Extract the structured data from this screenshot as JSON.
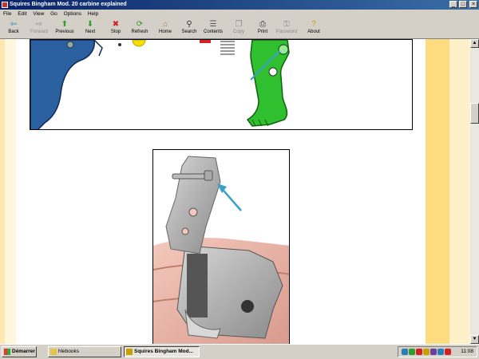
{
  "window": {
    "title": "Squires Bingham Mod. 20 carbine explained",
    "controls": [
      "_",
      "□",
      "×"
    ]
  },
  "menu": [
    "File",
    "Edit",
    "View",
    "Go",
    "Options",
    "Help"
  ],
  "toolbar": [
    {
      "label": "Back",
      "icon": "back-arrow-icon",
      "glyph": "⇦",
      "color": "#2a7fb8",
      "disabled": false
    },
    {
      "label": "Forward",
      "icon": "forward-arrow-icon",
      "glyph": "⇨",
      "color": "#8a8a8a",
      "disabled": true
    },
    {
      "label": "Previous",
      "icon": "up-arrow-icon",
      "glyph": "⬆",
      "color": "#2f9e2f",
      "disabled": false
    },
    {
      "label": "Next",
      "icon": "down-arrow-icon",
      "glyph": "⬇",
      "color": "#2f9e2f",
      "disabled": false
    },
    {
      "label": "Stop",
      "icon": "stop-icon",
      "glyph": "✖",
      "color": "#d42020",
      "disabled": false
    },
    {
      "label": "Refresh",
      "icon": "refresh-icon",
      "glyph": "⟳",
      "color": "#2f9e2f",
      "disabled": false
    },
    {
      "label": "Home",
      "icon": "home-icon",
      "glyph": "⌂",
      "color": "#b07a20",
      "disabled": false
    },
    {
      "label": "Search",
      "icon": "search-icon",
      "glyph": "⚲",
      "color": "#333333",
      "disabled": false
    },
    {
      "label": "Contents",
      "icon": "contents-icon",
      "glyph": "☰",
      "color": "#555555",
      "disabled": false
    },
    {
      "label": "Copy",
      "icon": "copy-icon",
      "glyph": "❐",
      "color": "#8a8a8a",
      "disabled": true
    },
    {
      "label": "Print",
      "icon": "print-icon",
      "glyph": "⎙",
      "color": "#333333",
      "disabled": false
    },
    {
      "label": "Password",
      "icon": "key-icon",
      "glyph": "⚿",
      "color": "#8a8a8a",
      "disabled": true
    },
    {
      "label": "About",
      "icon": "about-icon",
      "glyph": "?",
      "color": "#c8a000",
      "disabled": false
    }
  ],
  "taskbar": {
    "start_label": "Démarrer",
    "tasks": [
      {
        "label": "hlebooks",
        "active": false,
        "icon": "folder-icon",
        "color": "#e8c34a"
      },
      {
        "label": "Squires Bingham Mod...",
        "active": true,
        "icon": "ebook-icon",
        "color": "#c8a000"
      }
    ],
    "clock": "11:08",
    "tray_colors": [
      "#2a7fb8",
      "#2f9e2f",
      "#d42020",
      "#c8a000",
      "#6a3fa0",
      "#2a7fb8",
      "#d42020"
    ]
  },
  "colors": {
    "titlebar": "#0a246a",
    "chrome": "#d4d0c8",
    "stripe_left": "#fde8b0",
    "stripe_right": "#fddb7f",
    "trigger_part": "#2a5fa0",
    "sear_part": "#2fbf2f",
    "arrow": "#3aa0c8"
  }
}
